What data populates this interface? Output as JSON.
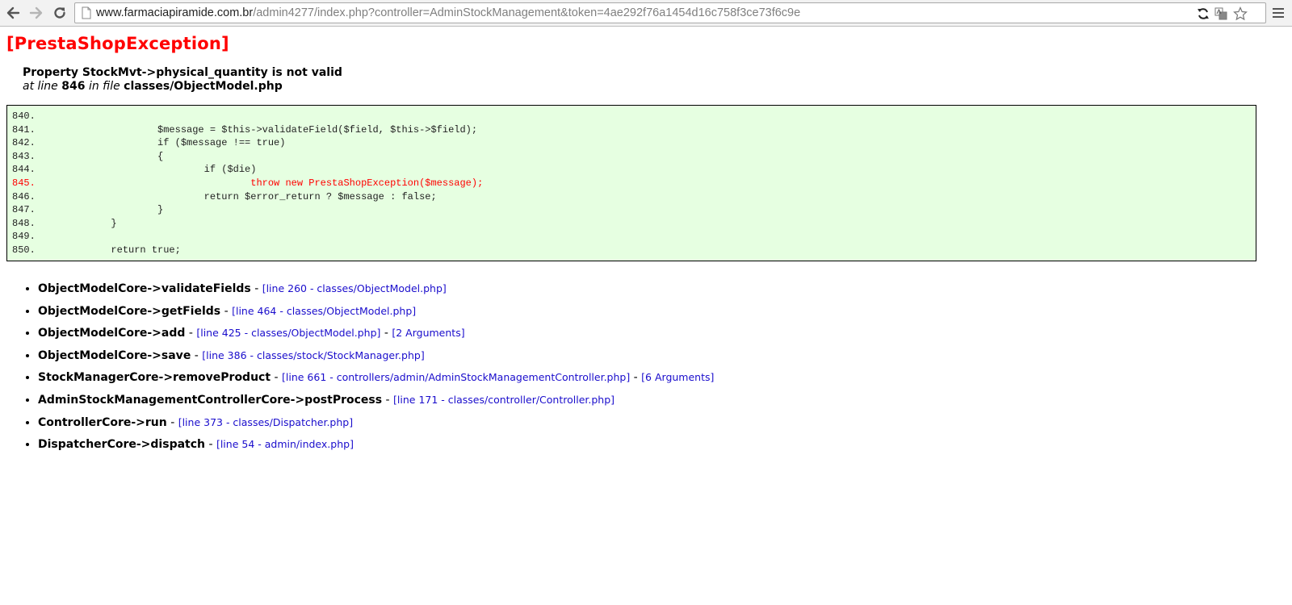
{
  "browser": {
    "url_host": "www.farmaciapiramide.com.br",
    "url_path": "/admin4277/index.php?controller=AdminStockManagement&token=4ae292f76a1454d16c758f3ce73f6c9e",
    "icons": {
      "back": "back-arrow-icon",
      "forward": "forward-arrow-icon",
      "reload": "reload-icon",
      "page": "page-icon",
      "sync": "sync-icon",
      "translate": "translate-icon",
      "bookmark": "star-icon",
      "menu": "hamburger-menu-icon"
    }
  },
  "exception": {
    "title": "[PrestaShopException]",
    "message": "Property StockMvt->physical_quantity is not valid",
    "at_line_prefix": "at line",
    "line": "846",
    "in_file_text": "in file",
    "file": "classes/ObjectModel.php"
  },
  "code": {
    "lines": [
      {
        "num": "840.",
        "text": ""
      },
      {
        "num": "841.",
        "text": "                    $message = $this->validateField($field, $this->$field);"
      },
      {
        "num": "842.",
        "text": "                    if ($message !== true)"
      },
      {
        "num": "843.",
        "text": "                    {"
      },
      {
        "num": "844.",
        "text": "                            if ($die)"
      },
      {
        "num": "845.",
        "text": "                                    throw new PrestaShopException($message);",
        "error": true
      },
      {
        "num": "846.",
        "text": "                            return $error_return ? $message : false;"
      },
      {
        "num": "847.",
        "text": "                    }"
      },
      {
        "num": "848.",
        "text": "            }"
      },
      {
        "num": "849.",
        "text": ""
      },
      {
        "num": "850.",
        "text": "            return true;"
      }
    ]
  },
  "trace": [
    {
      "fn": "ObjectModelCore->validateFields",
      "link": "[line 260 - classes/ObjectModel.php]"
    },
    {
      "fn": "ObjectModelCore->getFields",
      "link": "[line 464 - classes/ObjectModel.php]"
    },
    {
      "fn": "ObjectModelCore->add",
      "link": "[line 425 - classes/ObjectModel.php]",
      "args": "[2 Arguments]"
    },
    {
      "fn": "ObjectModelCore->save",
      "link": "[line 386 - classes/stock/StockManager.php]"
    },
    {
      "fn": "StockManagerCore->removeProduct",
      "link": "[line 661 - controllers/admin/AdminStockManagementController.php]",
      "args": "[6 Arguments]"
    },
    {
      "fn": "AdminStockManagementControllerCore->postProcess",
      "link": "[line 171 - classes/controller/Controller.php]"
    },
    {
      "fn": "ControllerCore->run",
      "link": "[line 373 - classes/Dispatcher.php]"
    },
    {
      "fn": "DispatcherCore->dispatch",
      "link": "[line 54 - admin/index.php]"
    }
  ],
  "colors": {
    "title": "#ff0000",
    "code_bg": "#e6ffe1",
    "error_line": "#ff0000",
    "link": "#1a0dcc"
  }
}
